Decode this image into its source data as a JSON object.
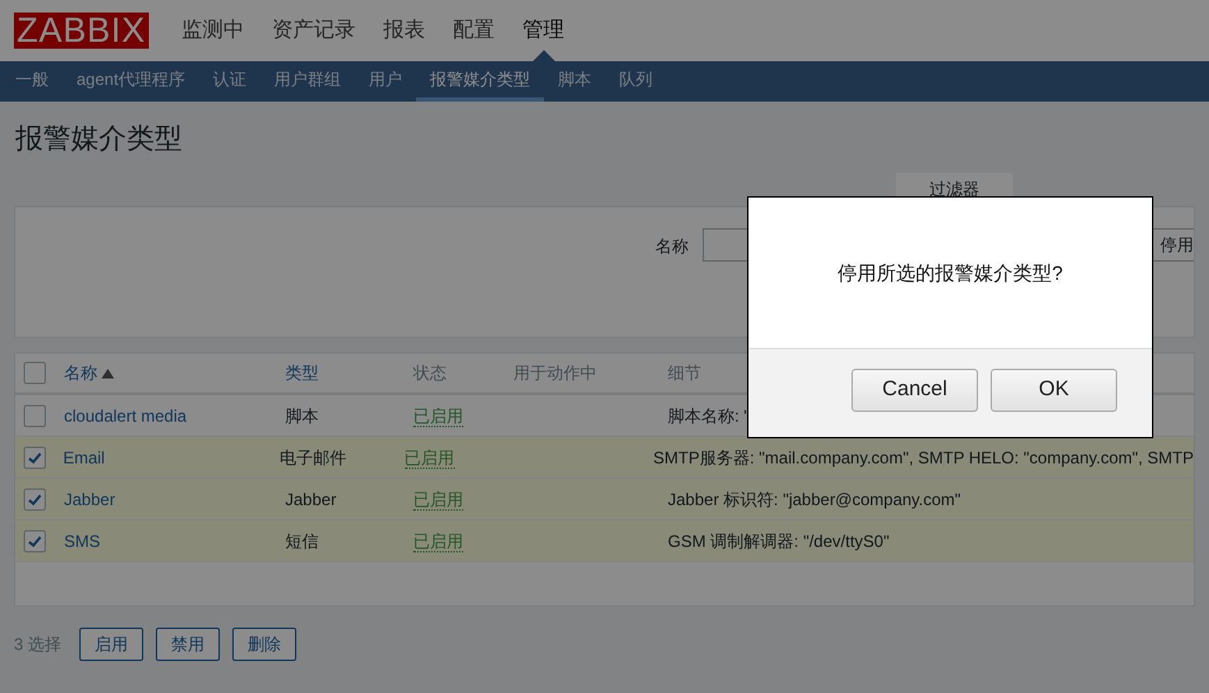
{
  "header": {
    "logo": "ZABBIX",
    "menu": [
      {
        "label": "监测中",
        "selected": false
      },
      {
        "label": "资产记录",
        "selected": false
      },
      {
        "label": "报表",
        "selected": false
      },
      {
        "label": "配置",
        "selected": false
      },
      {
        "label": "管理",
        "selected": true
      }
    ]
  },
  "sub_menu": [
    {
      "label": "一般",
      "selected": false
    },
    {
      "label": "agent代理程序",
      "selected": false
    },
    {
      "label": "认证",
      "selected": false
    },
    {
      "label": "用户群组",
      "selected": false
    },
    {
      "label": "用户",
      "selected": false
    },
    {
      "label": "报警媒介类型",
      "selected": true
    },
    {
      "label": "脚本",
      "selected": false
    },
    {
      "label": "队列",
      "selected": false
    }
  ],
  "page_title": "报警媒介类型",
  "filter": {
    "tab_label": "过滤器",
    "name_label": "名称",
    "status_button": "停用"
  },
  "table": {
    "all_checked": false,
    "columns": [
      {
        "label": "名称",
        "link": true,
        "sorted": true
      },
      {
        "label": "类型",
        "link": true,
        "sorted": false
      },
      {
        "label": "状态",
        "link": false,
        "sorted": false
      },
      {
        "label": "用于动作中",
        "link": false,
        "sorted": false
      },
      {
        "label": "细节",
        "link": false,
        "sorted": false
      }
    ],
    "rows": [
      {
        "checked": false,
        "name": "cloudalert media",
        "type": "脚本",
        "status": "已启用",
        "details": "脚本名称: \""
      },
      {
        "checked": true,
        "name": "Email",
        "type": "电子邮件",
        "status": "已启用",
        "details": "SMTP服务器: \"mail.company.com\", SMTP HELO: \"company.com\", SMTP"
      },
      {
        "checked": true,
        "name": "Jabber",
        "type": "Jabber",
        "status": "已启用",
        "details": "Jabber 标识符: \"jabber@company.com\""
      },
      {
        "checked": true,
        "name": "SMS",
        "type": "短信",
        "status": "已启用",
        "details": "GSM 调制解调器: \"/dev/ttyS0\""
      }
    ]
  },
  "footer": {
    "selected_count": "3 选择",
    "buttons": [
      "启用",
      "禁用",
      "删除"
    ]
  },
  "dialog": {
    "message": "停用所选的报警媒介类型?",
    "buttons": [
      "Cancel",
      "OK"
    ]
  }
}
